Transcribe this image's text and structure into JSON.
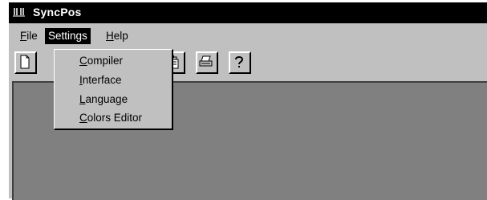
{
  "window": {
    "title": "SyncPos"
  },
  "menubar": {
    "file": {
      "prefix": "",
      "accel": "F",
      "rest": "ile"
    },
    "settings": {
      "prefix": "",
      "accel": "",
      "rest": "Settings"
    },
    "help": {
      "prefix": "",
      "accel": "H",
      "rest": "elp"
    }
  },
  "settings_menu": {
    "compiler": {
      "accel": "C",
      "rest": "ompiler"
    },
    "interface": {
      "accel": "I",
      "rest": "nterface"
    },
    "language": {
      "accel": "L",
      "rest": "anguage"
    },
    "colors_editor": {
      "accel": "C",
      "rest": "olors Editor"
    }
  },
  "toolbar": {
    "buttons": [
      "new-document-icon",
      "paste-icon",
      "print-icon",
      "help-icon"
    ]
  },
  "colors": {
    "titlebar": "#000000",
    "face": "#c0c0c0",
    "client": "#808080"
  }
}
